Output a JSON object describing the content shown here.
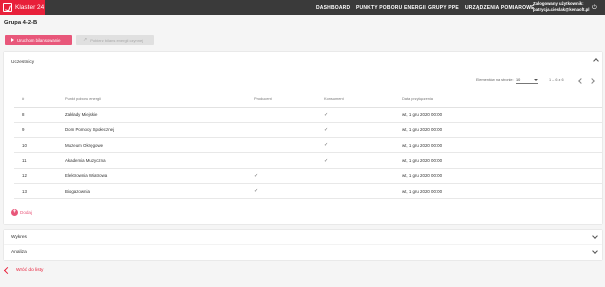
{
  "brand": {
    "name": "Klaster 24"
  },
  "nav": [
    {
      "label": "DASHBOARD"
    },
    {
      "label": "PUNKTY POBORU ENERGII"
    },
    {
      "label": "GRUPY PPE"
    },
    {
      "label": "URZĄDZENIA POMIAROWE"
    }
  ],
  "user": {
    "line1": "Zalogowany użytkownik:",
    "line2": "patrycja.cieslak@kenaoft.pl"
  },
  "page": {
    "title": "Grupa 4-2-B"
  },
  "actions": {
    "primary_label": "Uruchom bilansowanie",
    "secondary_label": "Pobierz bilans energii czynnej"
  },
  "participants": {
    "title": "Uczestnicy",
    "paginator": {
      "label": "Elementów na stronie:",
      "page_size": "10",
      "range": "1 – 6 z 6"
    },
    "columns": [
      "#",
      "Punkt poboru energii",
      "Producent",
      "Konsument",
      "Data przyłączenia"
    ],
    "rows": [
      {
        "id": "8",
        "name": "Zakłady Miejskie",
        "producer": "",
        "consumer": "✓",
        "date": "wt, 1 gru 2020 00:00"
      },
      {
        "id": "9",
        "name": "Dom Pomocy Społecznej",
        "producer": "",
        "consumer": "✓",
        "date": "wt, 1 gru 2020 00:00"
      },
      {
        "id": "10",
        "name": "Muzeum Okręgowe",
        "producer": "",
        "consumer": "✓",
        "date": "wt, 1 gru 2020 00:00"
      },
      {
        "id": "11",
        "name": "Akademia Muzyczna",
        "producer": "",
        "consumer": "✓",
        "date": "wt, 1 gru 2020 00:00"
      },
      {
        "id": "12",
        "name": "Elektrownia Wiatrowa",
        "producer": "✓",
        "consumer": "",
        "date": "wt, 1 gru 2020 00:00"
      },
      {
        "id": "13",
        "name": "Biogazownia",
        "producer": "✓",
        "consumer": "",
        "date": "wt, 1 gru 2020 00:00"
      }
    ],
    "add_label": "Dodaj"
  },
  "panels": {
    "chart_label": "Wykres",
    "analysis_label": "Analiza"
  },
  "back": {
    "label": "Wróć do listy"
  },
  "colors": {
    "brand": "#e8203a",
    "accent": "#e8577a",
    "topbar": "#3a3a3a"
  }
}
